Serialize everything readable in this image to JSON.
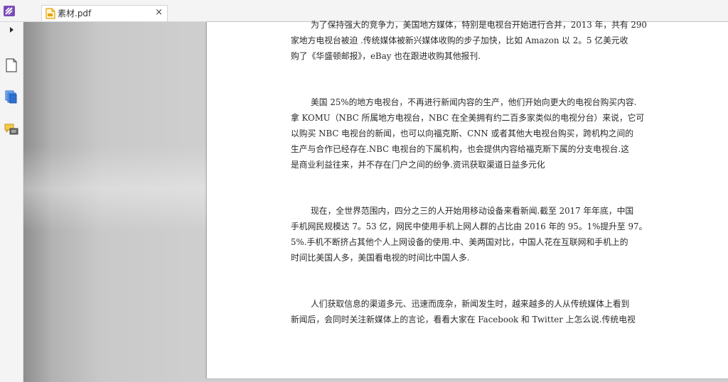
{
  "tab": {
    "title": "素材.pdf",
    "close": "×"
  },
  "document": {
    "paragraphs": [
      {
        "lines": [
          "为了保持强大的竞争力，美国地方媒体，特别是电视台开始进行合并，2013 年，共有 290",
          "家地方电视台被迫 .传统媒体被新兴媒体收购的步子加快，比如 Amazon 以 2。5 亿美元收",
          "购了《华盛顿邮报》，eBay 也在跟进收购其他报刊."
        ]
      },
      {
        "lines": [
          "美国 25%的地方电视台，不再进行新闻内容的生产，他们开始向更大的电视台购买内容.",
          "拿 KOMU（NBC 所属地方电视台，NBC 在全美拥有约二百多家类似的电视分台）来说，它可",
          "以购买 NBC 电视台的新闻，也可以向福克斯、CNN 或者其他大电视台购买，跨机构之间的",
          "生产与合作已经存在.NBC 电视台的下属机构，也会提供内容给福克斯下属的分支电视台.这",
          "是商业利益往来，并不存在门户之间的纷争.资讯获取渠道日益多元化"
        ]
      },
      {
        "lines": [
          "现在，全世界范围内，四分之三的人开始用移动设备来看新闻.截至 2017 年年底，中国",
          "手机网民规模达 7。53 亿，网民中使用手机上网人群的占比由 2016 年的 95。1%提升至 97。",
          "5%.手机不断挤占其他个人上网设备的使用.中、美两国对比，中国人花在互联网和手机上的",
          "时间比美国人多，美国看电视的时间比中国人多."
        ]
      },
      {
        "lines": [
          "人们获取信息的渠道多元、迅速而庞杂，新闻发生时，越来越多的人从传统媒体上看到",
          "新闻后，会同时关注新媒体上的言论，看看大家在 Facebook 和 Twitter 上怎么说.传统电视"
        ]
      }
    ]
  },
  "icons": {
    "app_logo": "pdf-reader-logo-icon",
    "tab_file": "pdf-file-icon",
    "panel_toggle": "expand-arrow-icon",
    "page_thumbnails": "page-icon",
    "bookmarks": "layers-icon",
    "comments": "comments-icon"
  },
  "colors": {
    "accent": "#7b4bb8",
    "file_icon": "#e8a200",
    "nav_icon_blue": "#2f6fd0",
    "comment_icon": "#e0b030"
  }
}
